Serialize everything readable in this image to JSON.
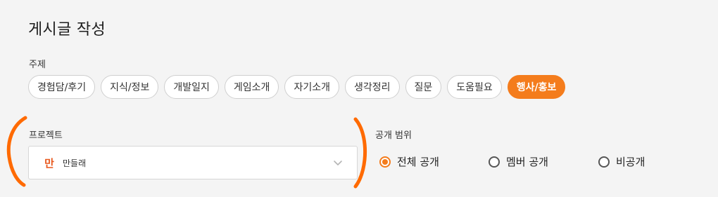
{
  "page": {
    "title": "게시글 작성"
  },
  "topic": {
    "label": "주제",
    "options": [
      "경험담/후기",
      "지식/정보",
      "개발일지",
      "게임소개",
      "자기소개",
      "생각정리",
      "질문",
      "도움필요",
      "행사/홍보"
    ],
    "selected": "행사/홍보"
  },
  "project": {
    "label": "프로젝트",
    "logo_text": "만",
    "selected_name": "만들래",
    "chevron_icon": "chevron-down-icon"
  },
  "visibility": {
    "label": "공개 범위",
    "options": [
      "전체 공개",
      "멤버 공개",
      "비공개"
    ],
    "selected": "전체 공개"
  },
  "colors": {
    "accent": "#f47c1c",
    "annotation": "#ff6a00",
    "background": "#f4f4f4"
  }
}
